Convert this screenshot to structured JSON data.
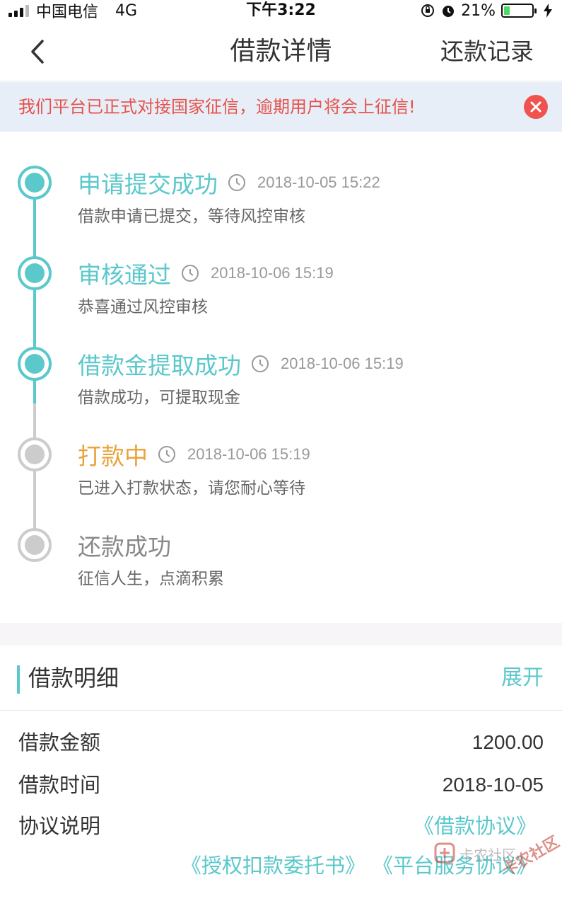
{
  "status_bar": {
    "carrier": "中国电信",
    "network": "4G",
    "time": "下午3:22",
    "battery_percent": "21%",
    "battery_level": 0.21
  },
  "nav": {
    "title": "借款详情",
    "right_label": "还款记录"
  },
  "notice": {
    "text": "我们平台已正式对接国家征信，逾期用户将会上征信!"
  },
  "timeline": {
    "active_color": "#5bc8cb",
    "inactive_color": "#cccccc",
    "pending_title_color": "#e8a33c",
    "steps": [
      {
        "title": "申请提交成功",
        "time": "2018-10-05 15:22",
        "desc": "借款申请已提交，等待风控审核",
        "state": "done"
      },
      {
        "title": "审核通过",
        "time": "2018-10-06 15:19",
        "desc": "恭喜通过风控审核",
        "state": "done"
      },
      {
        "title": "借款金提取成功",
        "time": "2018-10-06 15:19",
        "desc": "借款成功，可提取现金",
        "state": "done"
      },
      {
        "title": "打款中",
        "time": "2018-10-06 15:19",
        "desc": "已进入打款状态，请您耐心等待",
        "state": "current"
      },
      {
        "title": "还款成功",
        "time": "",
        "desc": "征信人生，点滴积累",
        "state": "pending"
      }
    ]
  },
  "details": {
    "title": "借款明细",
    "expand_label": "展开",
    "rows": [
      {
        "label": "借款金额",
        "value": "1200.00"
      },
      {
        "label": "借款时间",
        "value": "2018-10-05"
      },
      {
        "label": "协议说明",
        "value": "《借款协议》"
      }
    ],
    "extra_links": [
      "《授权扣款委托书》",
      "《平台服务协议》"
    ]
  },
  "watermark": {
    "line1": "卡农社区",
    "line2": "卡农社区"
  }
}
